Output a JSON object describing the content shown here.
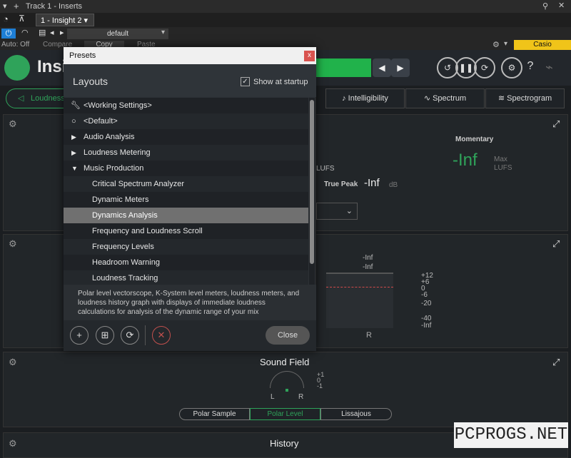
{
  "host": {
    "track_title": "Track 1 - Inserts",
    "insert_name": "1 - Insight 2",
    "preset_name": "default",
    "auto_off": "Auto: Off",
    "compare": "Compare",
    "copy": "Copy",
    "paste": "Paste",
    "device": "Casio"
  },
  "plugin": {
    "name": "Insight 2"
  },
  "tabs": [
    "Loudness",
    "Intelligibility",
    "Spectrum",
    "Spectrogram"
  ],
  "meters": {
    "momentary_label": "Momentary",
    "momentary_value": "-Inf",
    "max_label": "Max",
    "lufs_unit": "LUFS",
    "true_peak_label": "True Peak",
    "true_peak_value": "-Inf",
    "db_unit": "dB",
    "channel_r": "R",
    "scale_top1": "-Inf",
    "scale_top2": "-Inf",
    "scale": [
      "+12",
      "+6",
      "0",
      "-6",
      "-20",
      "-40",
      "-Inf"
    ]
  },
  "dialog": {
    "title": "Presets",
    "close_x": "x",
    "heading": "Layouts",
    "show_at_startup": "Show at startup",
    "show_at_startup_checked": true,
    "items": [
      {
        "label": "<Working Settings>",
        "icon": "wrench-icon"
      },
      {
        "label": "<Default>",
        "icon": "circle-icon"
      },
      {
        "label": "Audio Analysis",
        "icon": "triangle-right-icon"
      },
      {
        "label": "Loudness Metering",
        "icon": "triangle-right-icon"
      },
      {
        "label": "Music Production",
        "icon": "triangle-down-icon"
      },
      {
        "label": "Critical Spectrum Analyzer"
      },
      {
        "label": "Dynamic Meters"
      },
      {
        "label": "Dynamics Analysis",
        "selected": true
      },
      {
        "label": "Frequency and Loudness Scroll"
      },
      {
        "label": "Frequency Levels"
      },
      {
        "label": "Headroom Warning"
      },
      {
        "label": "Loudness Tracking"
      }
    ],
    "description": "Polar level vectorscope, K-System level meters, loudness meters, and loudness history graph with displays of immediate loudness calculations for analysis of the dynamic range of your mix",
    "close_button": "Close"
  },
  "sound_field": {
    "title": "Sound Field",
    "left": "L",
    "right": "R",
    "scale": [
      "+1",
      "0",
      "-1"
    ],
    "modes": [
      "Polar Sample",
      "Polar Level",
      "Lissajous"
    ],
    "active_mode": "Polar Level"
  },
  "history": {
    "title": "History"
  },
  "watermark": "PCPROGS.NET"
}
